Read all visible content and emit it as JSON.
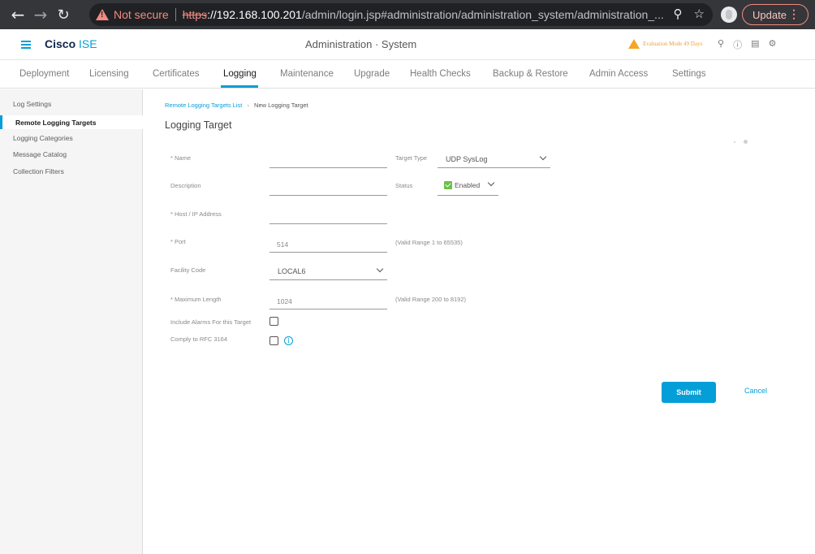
{
  "browser": {
    "back_icon": "arrow-left-icon",
    "forward_icon": "arrow-right-icon",
    "reload_icon": "reload-icon",
    "not_secure": "Not secure",
    "url_scheme": "https",
    "url_host": "://192.168.100.201",
    "url_path": "/admin/login.jsp#administration/administration_system/administration_...",
    "update_label": "Update"
  },
  "header": {
    "brand_bold": "Cisco",
    "brand_light": "ISE",
    "page_heading": "Administration · System",
    "eval_text": "Evaluation Mode 49 Days",
    "accent_color": "#049fd9"
  },
  "tabs": [
    {
      "label": "Deployment"
    },
    {
      "label": "Licensing"
    },
    {
      "label": "Certificates"
    },
    {
      "label": "Logging",
      "active": true
    },
    {
      "label": "Maintenance"
    },
    {
      "label": "Upgrade"
    },
    {
      "label": "Health Checks"
    },
    {
      "label": "Backup & Restore"
    },
    {
      "label": "Admin Access"
    },
    {
      "label": "Settings"
    }
  ],
  "sidebar": {
    "items": [
      {
        "label": "Log Settings"
      },
      {
        "label": "Remote Logging Targets",
        "active": true
      },
      {
        "label": "Logging Categories"
      },
      {
        "label": "Message Catalog"
      },
      {
        "label": "Collection Filters"
      }
    ]
  },
  "breadcrumb": {
    "link": "Remote Logging Targets List",
    "current": "New Logging Target"
  },
  "form": {
    "title": "Logging Target",
    "name_label": "* Name",
    "name_value": "",
    "description_label": "Description",
    "description_value": "",
    "host_label": "* Host / IP Address",
    "host_value": "",
    "port_label": "* Port",
    "port_value": "514",
    "port_hint": "(Valid Range 1 to 65535)",
    "facility_label": "Facility Code",
    "facility_value": "LOCAL6",
    "maxlen_label": "* Maximum Length",
    "maxlen_value": "1024",
    "maxlen_hint": "(Valid Range 200 to 8192)",
    "alarms_label": "Include Alarms For this Target",
    "alarms_checked": false,
    "rfc_label": "Comply to RFC 3164",
    "rfc_checked": false,
    "target_type_label": "Target Type",
    "target_type_value": "UDP SysLog",
    "status_label": "Status",
    "status_value": "Enabled",
    "submit_label": "Submit",
    "cancel_label": "Cancel"
  }
}
